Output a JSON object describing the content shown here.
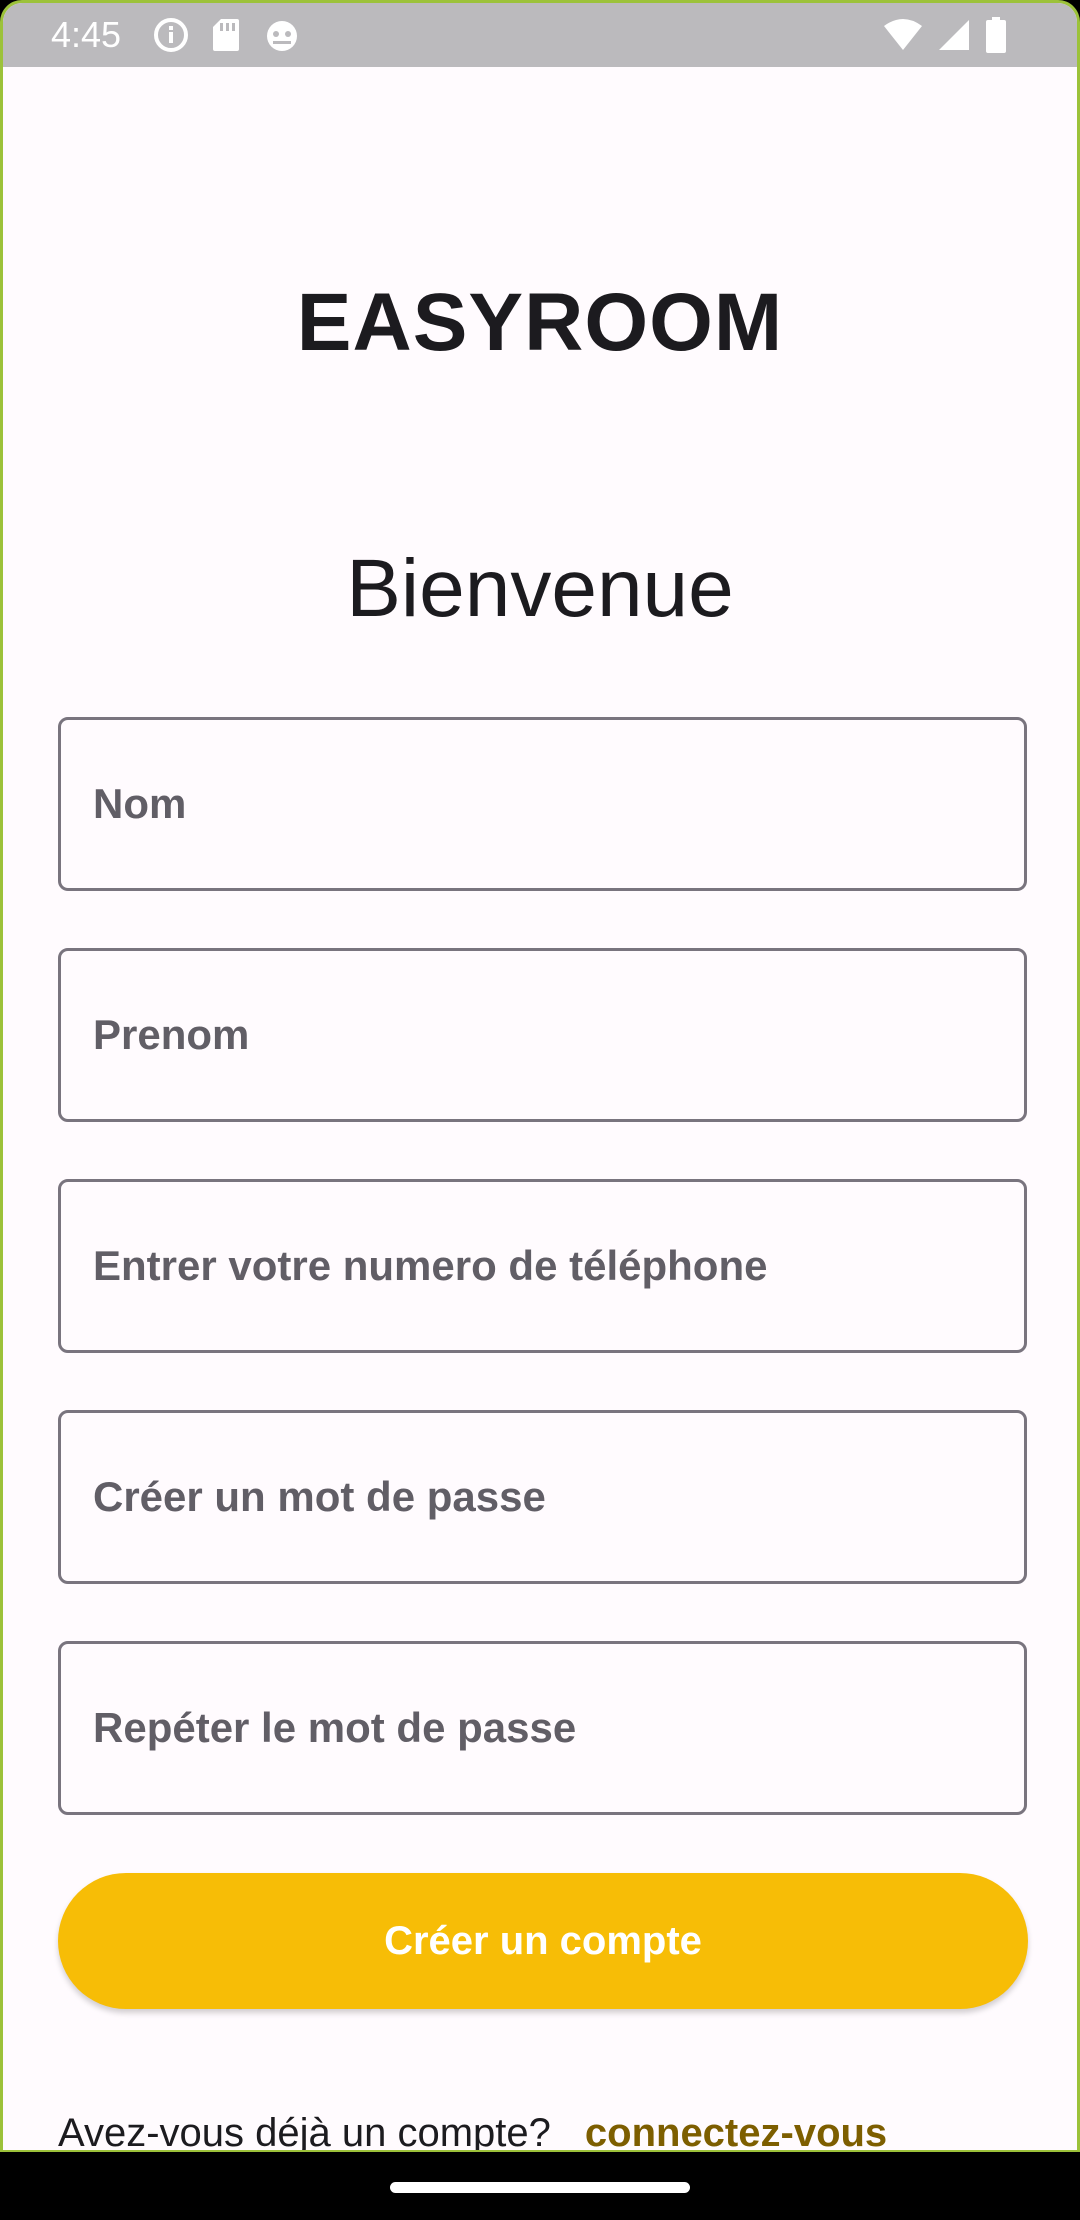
{
  "status_bar": {
    "time": "4:45",
    "left_icons": [
      "info-icon",
      "sd-card-icon",
      "android-robot-icon"
    ],
    "right_icons": [
      "wifi-icon",
      "cellular-signal-icon",
      "battery-icon"
    ]
  },
  "header": {
    "app_name": "EASYROOM",
    "welcome": "Bienvenue"
  },
  "form": {
    "fields": [
      {
        "placeholder": "Nom"
      },
      {
        "placeholder": "Prenom"
      },
      {
        "placeholder": "Entrer votre numero de téléphone"
      },
      {
        "placeholder": "Créer un mot de passe"
      },
      {
        "placeholder": "Repéter le mot de passe"
      }
    ],
    "submit_label": "Créer un compte"
  },
  "footer": {
    "question": "Avez-vous déjà un compte?",
    "link": "connectez-vous"
  },
  "colors": {
    "accent": "#f7bd06",
    "link": "#7d5e00",
    "status_bar": "#bbbabd",
    "background": "#fffbfe"
  }
}
